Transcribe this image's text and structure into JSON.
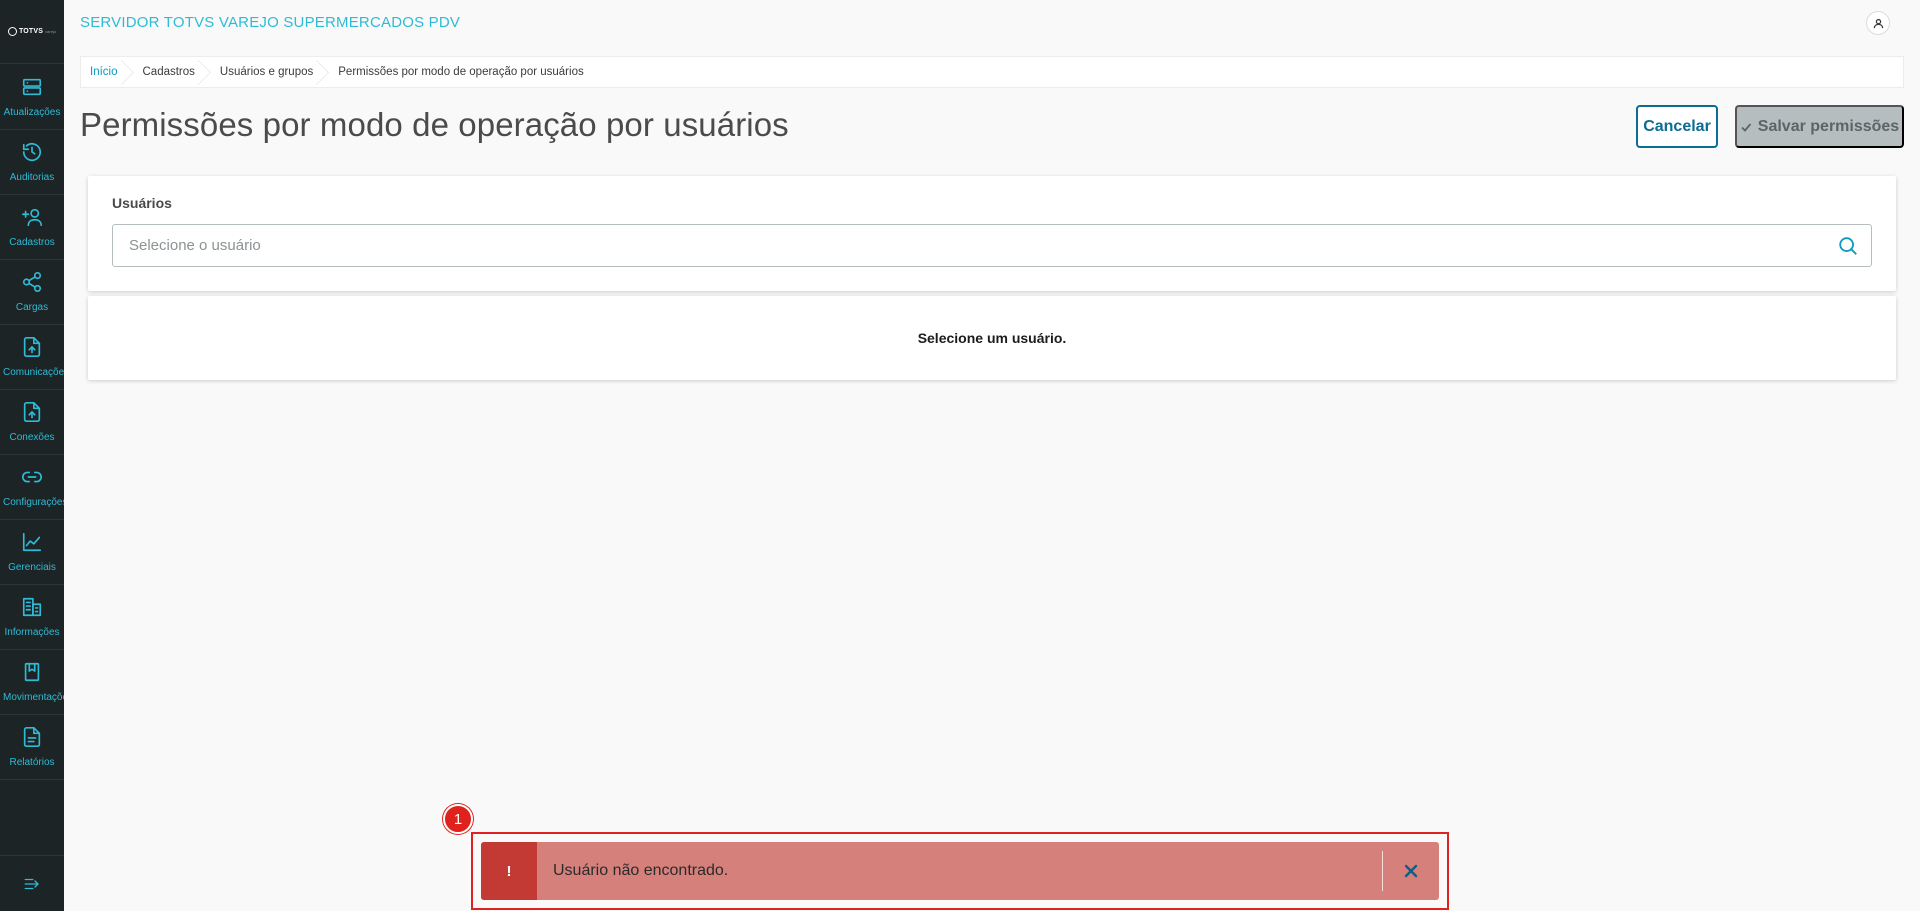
{
  "app": {
    "logo_text": "TOTVS",
    "logo_sub": "varejo",
    "title": "SERVIDOR TOTVS VAREJO SUPERMERCADOS PDV"
  },
  "sidebar": {
    "items": [
      {
        "label": "Atualizações",
        "icon": "server-icon"
      },
      {
        "label": "Auditorias",
        "icon": "history-icon"
      },
      {
        "label": "Cadastros",
        "icon": "add-user-icon"
      },
      {
        "label": "Cargas",
        "icon": "share-icon"
      },
      {
        "label": "Comunicações",
        "icon": "file-upload-icon"
      },
      {
        "label": "Conexões",
        "icon": "file-upload-icon"
      },
      {
        "label": "Configurações",
        "icon": "link-icon"
      },
      {
        "label": "Gerenciais",
        "icon": "chart-icon"
      },
      {
        "label": "Informações",
        "icon": "building-icon"
      },
      {
        "label": "Movimentações",
        "icon": "bookmark-icon"
      },
      {
        "label": "Relatórios",
        "icon": "document-icon"
      }
    ],
    "collapse_icon": "collapse-menu-icon"
  },
  "breadcrumb": {
    "items": [
      "Início",
      "Cadastros",
      "Usuários e grupos",
      "Permissões por modo de operação por usuários"
    ]
  },
  "page": {
    "title": "Permissões por modo de operação por usuários",
    "cancel_label": "Cancelar",
    "save_label": "Salvar permissões"
  },
  "users": {
    "label": "Usuários",
    "placeholder": "Selecione o usuário",
    "value": ""
  },
  "empty_state": {
    "text": "Selecione um usuário."
  },
  "notification": {
    "badge": "1",
    "icon_text": "!",
    "message": "Usuário não encontrado.",
    "colors": {
      "background": "#d6807c",
      "icon_bg": "#c23a33",
      "highlight": "#e0221f"
    }
  },
  "colors": {
    "accent": "#2ebbd6",
    "primary_dark": "#0c6c94",
    "sidebar_bg": "#1d2426"
  }
}
